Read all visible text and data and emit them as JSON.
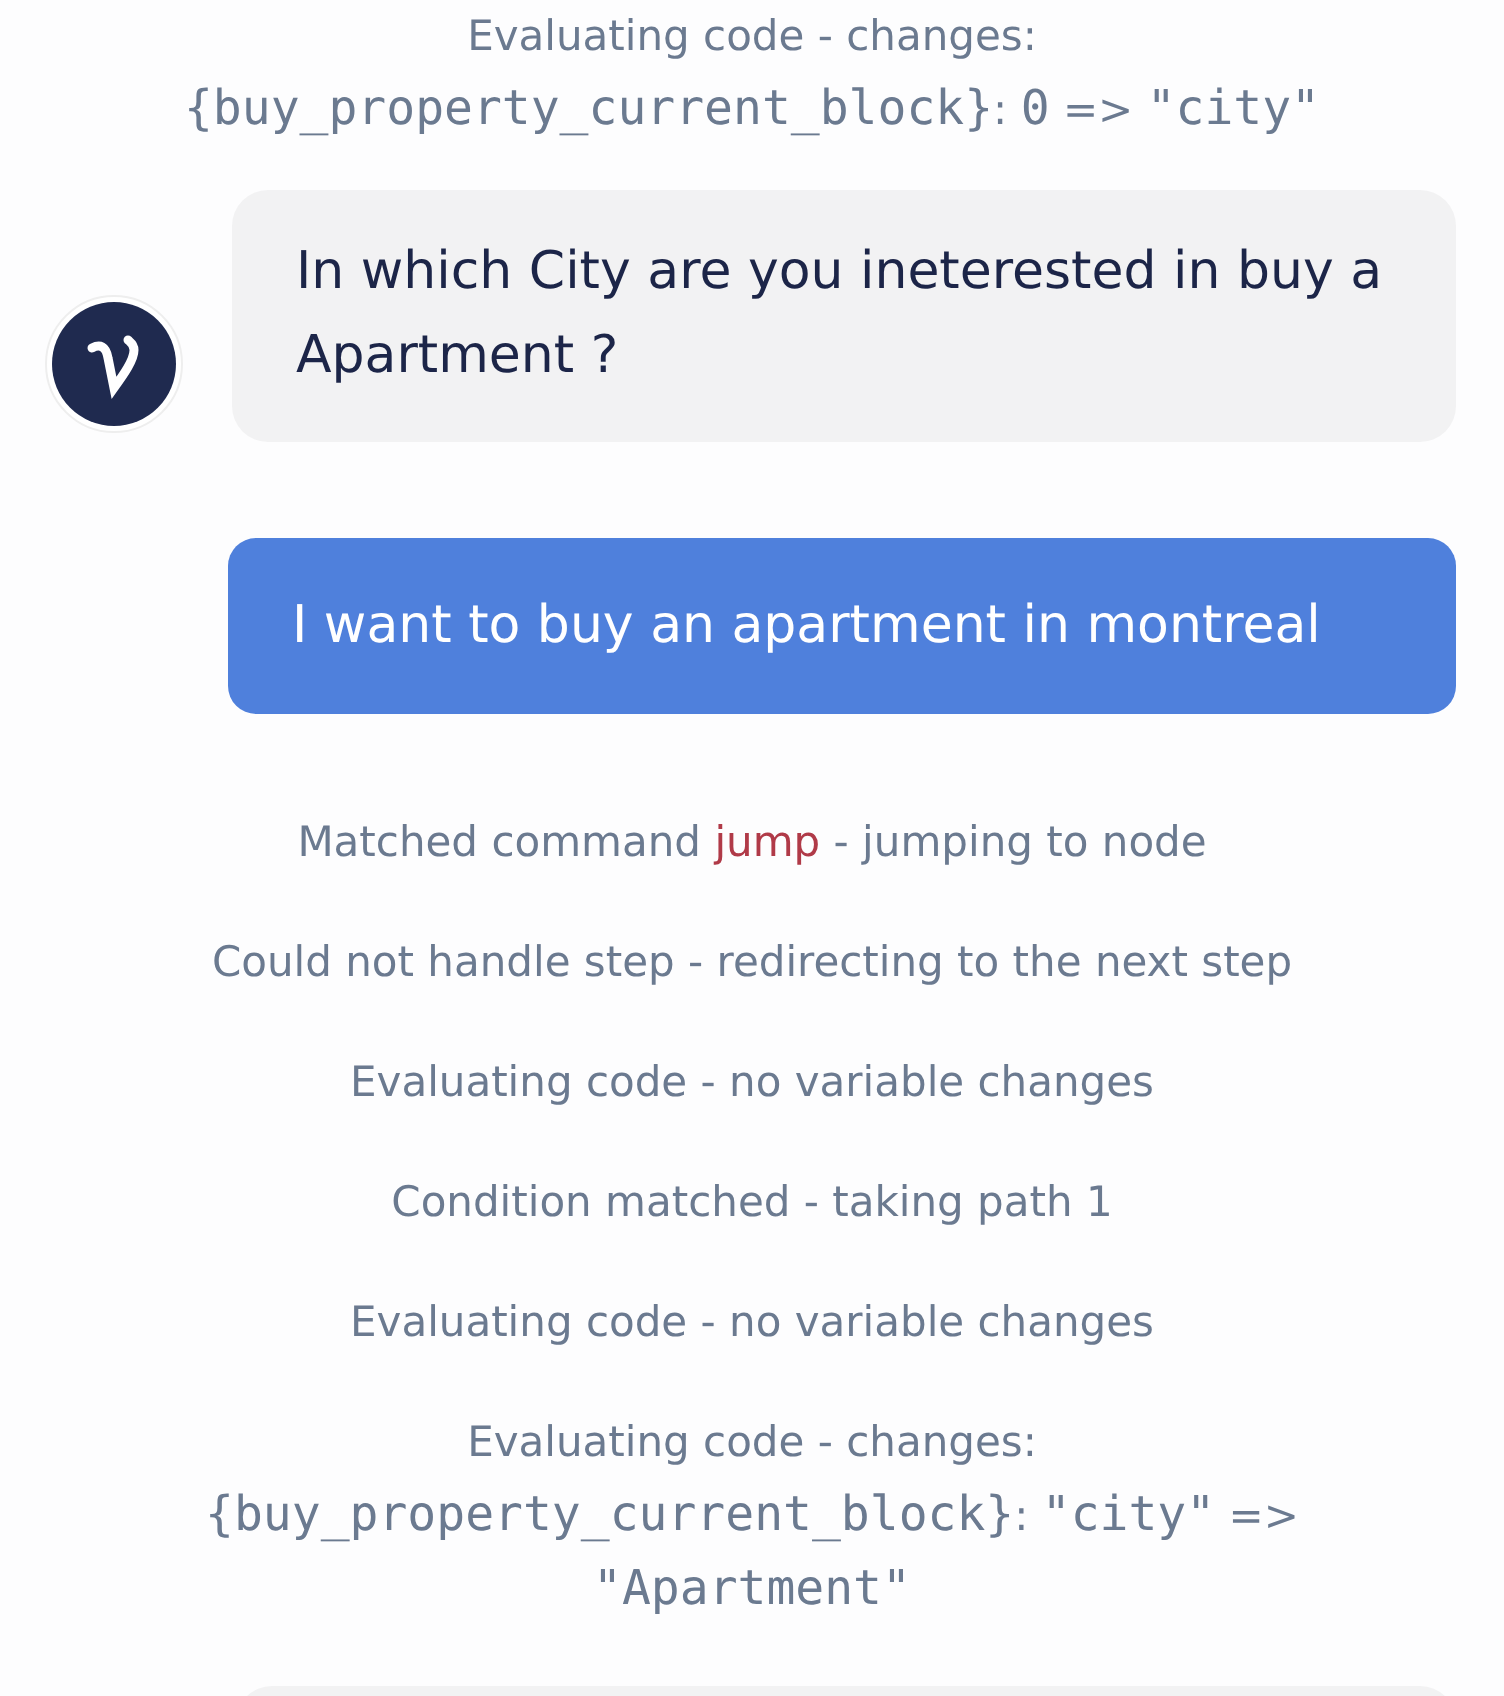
{
  "messages": [
    {
      "kind": "log",
      "lines": [
        [
          {
            "kind": "text",
            "text": "Evaluating code - changes:"
          }
        ],
        [
          {
            "kind": "code",
            "text": "{buy_property_current_block}"
          },
          {
            "kind": "text",
            "text": ": "
          },
          {
            "kind": "code",
            "text": "0"
          },
          {
            "kind": "text",
            "text": " => "
          },
          {
            "kind": "code",
            "text": "\"city\""
          }
        ]
      ]
    },
    {
      "kind": "bot",
      "text": "In which City are you ineterested in buy a Apartment ?"
    },
    {
      "kind": "user",
      "text": "I want to buy an apartment in montreal"
    },
    {
      "kind": "log",
      "lines": [
        [
          {
            "kind": "text",
            "text": "Matched command "
          },
          {
            "kind": "command",
            "text": "jump"
          },
          {
            "kind": "text",
            "text": " - jumping to node"
          }
        ]
      ]
    },
    {
      "kind": "log",
      "lines": [
        [
          {
            "kind": "text",
            "text": "Could not handle step - redirecting to the next step"
          }
        ]
      ]
    },
    {
      "kind": "log",
      "lines": [
        [
          {
            "kind": "text",
            "text": "Evaluating code - no variable changes"
          }
        ]
      ]
    },
    {
      "kind": "log",
      "lines": [
        [
          {
            "kind": "text",
            "text": "Condition matched - taking path 1"
          }
        ]
      ]
    },
    {
      "kind": "log",
      "lines": [
        [
          {
            "kind": "text",
            "text": "Evaluating code - no variable changes"
          }
        ]
      ]
    },
    {
      "kind": "log",
      "lines": [
        [
          {
            "kind": "text",
            "text": "Evaluating code - changes:"
          }
        ],
        [
          {
            "kind": "code",
            "text": "{buy_property_current_block}"
          },
          {
            "kind": "text",
            "text": ": "
          },
          {
            "kind": "code",
            "text": "\"city\""
          },
          {
            "kind": "text",
            "text": " =>"
          }
        ],
        [
          {
            "kind": "code",
            "text": "\"Apartment\""
          }
        ]
      ]
    },
    {
      "kind": "bot_partial"
    }
  ]
}
